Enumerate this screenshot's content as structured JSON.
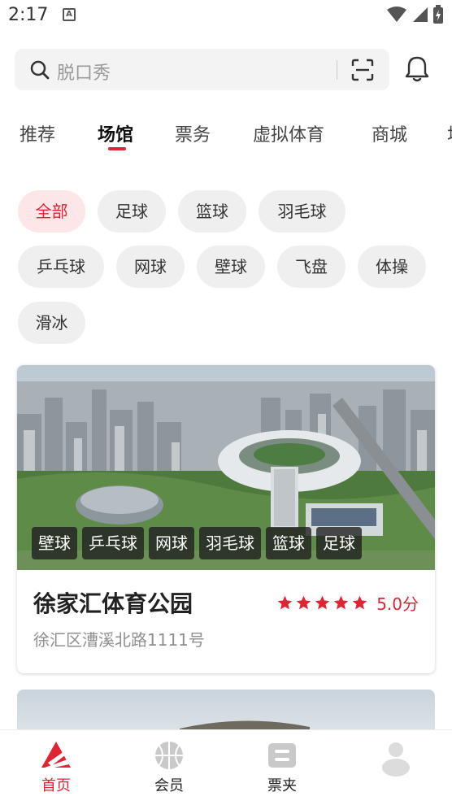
{
  "status_bar": {
    "time": "2:17",
    "notification_badge": "A"
  },
  "search": {
    "placeholder": "脱口秀"
  },
  "tabs": [
    {
      "label": "推荐"
    },
    {
      "label": "场馆",
      "active": true
    },
    {
      "label": "票务"
    },
    {
      "label": "虚拟体育"
    },
    {
      "label": "商城"
    },
    {
      "label": "场"
    }
  ],
  "filters": [
    {
      "label": "全部",
      "active": true
    },
    {
      "label": "足球"
    },
    {
      "label": "篮球"
    },
    {
      "label": "羽毛球"
    },
    {
      "label": "乒乓球"
    },
    {
      "label": "网球"
    },
    {
      "label": "壁球"
    },
    {
      "label": "飞盘"
    },
    {
      "label": "体操"
    },
    {
      "label": "滑冰"
    }
  ],
  "venue": {
    "name": "徐家汇体育公园",
    "rating_stars": 5,
    "rating_text": "5.0分",
    "address": "徐汇区漕溪北路1111号",
    "tags": [
      "壁球",
      "乒乓球",
      "网球",
      "羽毛球",
      "篮球",
      "足球"
    ]
  },
  "bottom_nav": [
    {
      "label": "首页",
      "icon": "home-logo-icon",
      "active": true
    },
    {
      "label": "会员",
      "icon": "basketball-icon"
    },
    {
      "label": "票夹",
      "icon": "ticket-icon"
    },
    {
      "label": "",
      "icon": "profile-avatar-icon"
    }
  ],
  "colors": {
    "accent": "#e02434",
    "chip_bg": "#efefef",
    "chip_active_bg": "#fde6e8"
  }
}
